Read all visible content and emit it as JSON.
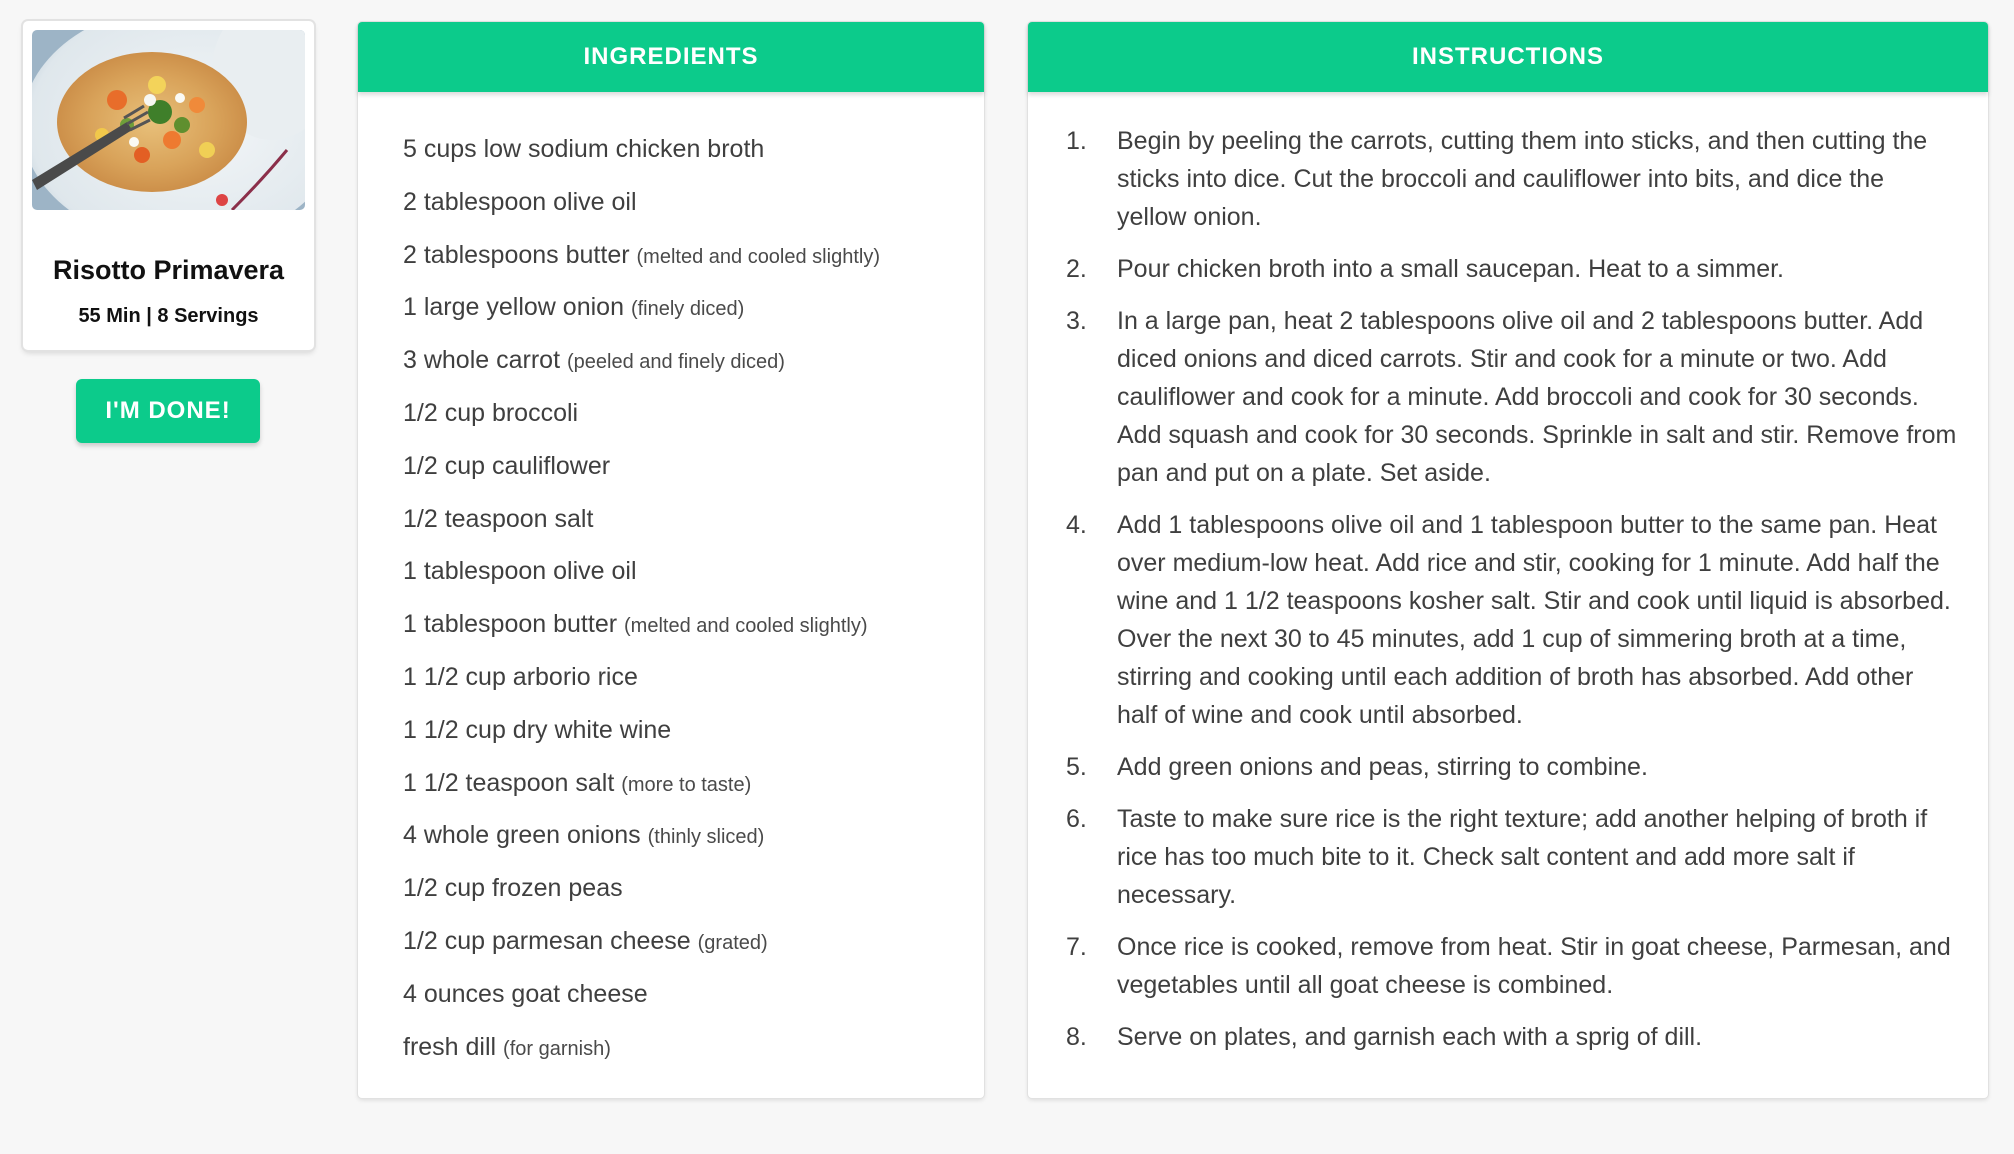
{
  "recipe": {
    "photo_alt": "risotto-dish-photo",
    "title": "Risotto Primavera",
    "meta": "55 Min | 8 Servings",
    "done_label": "I'M DONE!"
  },
  "colors": {
    "accent": "#0ccb8b",
    "background": "#f7f7f7",
    "text": "#3f3f3f"
  },
  "ingredients": {
    "header": "INGREDIENTS",
    "items": [
      {
        "name": "5 cups low sodium chicken broth",
        "note": ""
      },
      {
        "name": "2 tablespoon olive oil",
        "note": ""
      },
      {
        "name": "2 tablespoons butter",
        "note": "(melted and cooled slightly)"
      },
      {
        "name": "1 large yellow onion",
        "note": "(finely diced)"
      },
      {
        "name": "3 whole carrot",
        "note": "(peeled and finely diced)"
      },
      {
        "name": "1/2 cup broccoli",
        "note": ""
      },
      {
        "name": "1/2 cup cauliflower",
        "note": ""
      },
      {
        "name": "1/2 teaspoon salt",
        "note": ""
      },
      {
        "name": "1 tablespoon olive oil",
        "note": ""
      },
      {
        "name": "1 tablespoon butter",
        "note": "(melted and cooled slightly)"
      },
      {
        "name": "1 1/2 cup arborio rice",
        "note": ""
      },
      {
        "name": "1 1/2 cup dry white wine",
        "note": ""
      },
      {
        "name": "1 1/2 teaspoon salt",
        "note": "(more to taste)"
      },
      {
        "name": "4 whole green onions",
        "note": "(thinly sliced)"
      },
      {
        "name": "1/2 cup frozen peas",
        "note": ""
      },
      {
        "name": "1/2 cup parmesan cheese",
        "note": "(grated)"
      },
      {
        "name": "4 ounces goat cheese",
        "note": ""
      },
      {
        "name": "fresh dill",
        "note": "(for garnish)"
      }
    ]
  },
  "instructions": {
    "header": "INSTRUCTIONS",
    "steps": [
      {
        "num": "1.",
        "text": "Begin by peeling the carrots, cutting them into sticks, and then cutting the sticks into dice. Cut the broccoli and cauliflower into bits, and dice the yellow onion."
      },
      {
        "num": "2.",
        "text": "Pour chicken broth into a small saucepan. Heat to a simmer."
      },
      {
        "num": "3.",
        "text": "In a large pan, heat 2 tablespoons olive oil and 2 tablespoons butter. Add diced onions and diced carrots. Stir and cook for a minute or two. Add cauliflower and cook for a minute. Add broccoli and cook for 30 seconds. Add squash and cook for 30 seconds. Sprinkle in salt and stir. Remove from pan and put on a plate. Set aside."
      },
      {
        "num": "4.",
        "text": "Add 1 tablespoons olive oil and 1 tablespoon butter to the same pan. Heat over medium-low heat. Add rice and stir, cooking for 1 minute. Add half the wine and 1 1/2 teaspoons kosher salt. Stir and cook until liquid is absorbed. Over the next 30 to 45 minutes, add 1 cup of simmering broth at a time, stirring and cooking until each addition of broth has absorbed. Add other half of wine and cook until absorbed."
      },
      {
        "num": "5.",
        "text": "Add green onions and peas, stirring to combine."
      },
      {
        "num": "6.",
        "text": "Taste to make sure rice is the right texture; add another helping of broth if rice has too much bite to it. Check salt content and add more salt if necessary."
      },
      {
        "num": "7.",
        "text": "Once rice is cooked, remove from heat. Stir in goat cheese, Parmesan, and vegetables until all goat cheese is combined."
      },
      {
        "num": "8.",
        "text": "Serve on plates, and garnish each with a sprig of dill."
      }
    ]
  }
}
